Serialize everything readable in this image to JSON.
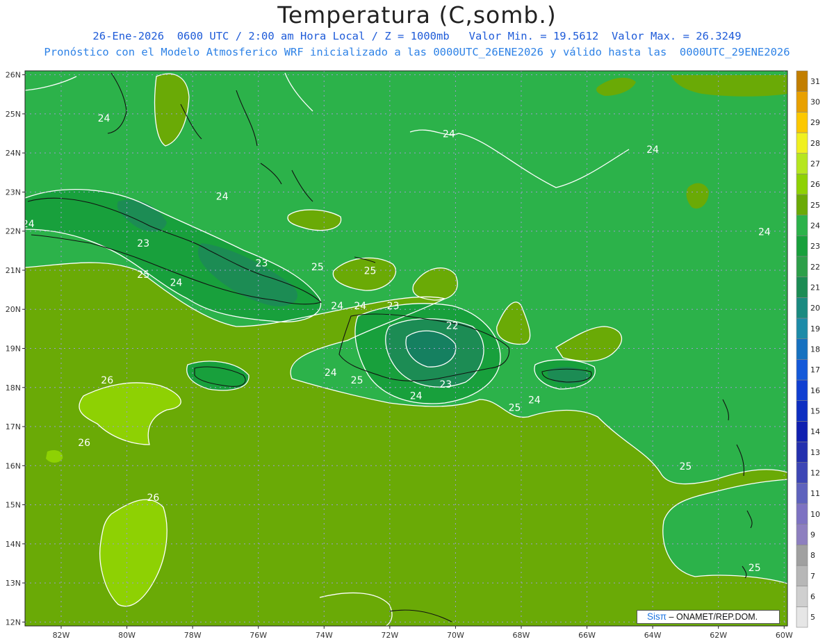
{
  "title": "Temperatura (C,somb.)",
  "subtitle_1": "26-Ene-2026  0600 UTC / 2:00 am Hora Local / Z = 1000mb   Valor Min. = 19.5612  Valor Max. = 26.3249",
  "subtitle_2": "Pronóstico con el Modelo Atmosferico WRF inicializado a las 0000UTC_26ENE2026 y válido hasta las  0000UTC_29ENE2026",
  "credit": {
    "brand": "Sisπ",
    "text": " – ONAMET/REP.DOM."
  },
  "map": {
    "lon_range": [
      -83.1,
      -59.9
    ],
    "lat_range": [
      11.9,
      26.1
    ],
    "lon_ticks": [
      "82W",
      "80W",
      "78W",
      "76W",
      "74W",
      "72W",
      "70W",
      "68W",
      "66W",
      "64W",
      "62W",
      "60W"
    ],
    "lat_ticks": [
      "12N",
      "13N",
      "14N",
      "15N",
      "16N",
      "17N",
      "18N",
      "19N",
      "20N",
      "21N",
      "22N",
      "23N",
      "24N",
      "25N",
      "26N"
    ],
    "gridlines": true,
    "fill_colors": {
      "22": "#1c8c54",
      "23": "#18a03c",
      "24": "#2cb24a",
      "25": "#6aaa06",
      "26": "#8ed103",
      "21_core": "#158060"
    },
    "contour_labels": [
      {
        "text": "24",
        "lon": -80.7,
        "lat": 24.8
      },
      {
        "text": "24",
        "lon": -70.2,
        "lat": 24.4
      },
      {
        "text": "24",
        "lon": -64.0,
        "lat": 24.0
      },
      {
        "text": "24",
        "lon": -77.1,
        "lat": 22.8
      },
      {
        "text": "24",
        "lon": -83.0,
        "lat": 22.1
      },
      {
        "text": "24",
        "lon": -60.6,
        "lat": 21.9
      },
      {
        "text": "23",
        "lon": -79.5,
        "lat": 21.6
      },
      {
        "text": "23",
        "lon": -75.9,
        "lat": 21.1
      },
      {
        "text": "25",
        "lon": -74.2,
        "lat": 21.0
      },
      {
        "text": "25",
        "lon": -72.6,
        "lat": 20.9
      },
      {
        "text": "25",
        "lon": -79.5,
        "lat": 20.8
      },
      {
        "text": "24",
        "lon": -78.5,
        "lat": 20.6
      },
      {
        "text": "24",
        "lon": -73.6,
        "lat": 20.0
      },
      {
        "text": "24",
        "lon": -72.9,
        "lat": 20.0
      },
      {
        "text": "23",
        "lon": -71.9,
        "lat": 20.0
      },
      {
        "text": "22",
        "lon": -70.1,
        "lat": 19.5
      },
      {
        "text": "24",
        "lon": -73.8,
        "lat": 18.3
      },
      {
        "text": "25",
        "lon": -73.0,
        "lat": 18.1
      },
      {
        "text": "23",
        "lon": -70.3,
        "lat": 18.0
      },
      {
        "text": "24",
        "lon": -71.2,
        "lat": 17.7
      },
      {
        "text": "24",
        "lon": -67.6,
        "lat": 17.6
      },
      {
        "text": "25",
        "lon": -68.2,
        "lat": 17.4
      },
      {
        "text": "26",
        "lon": -80.6,
        "lat": 18.1
      },
      {
        "text": "26",
        "lon": -81.3,
        "lat": 16.5
      },
      {
        "text": "26",
        "lon": -79.2,
        "lat": 15.1
      },
      {
        "text": "25",
        "lon": -63.0,
        "lat": 15.9
      },
      {
        "text": "25",
        "lon": -60.9,
        "lat": 13.3
      }
    ]
  },
  "colorbar": {
    "levels": [
      "5",
      "6",
      "7",
      "8",
      "9",
      "10",
      "11",
      "12",
      "13",
      "14",
      "15",
      "16",
      "17",
      "18",
      "19",
      "20",
      "21",
      "22",
      "23",
      "24",
      "25",
      "26",
      "27",
      "28",
      "29",
      "30",
      "31"
    ],
    "colors": [
      "#e6e6e6",
      "#cfcfcf",
      "#b7b7b7",
      "#a0a0a0",
      "#8d7fbf",
      "#7d72c2",
      "#5e62bd",
      "#3d46b5",
      "#2430ae",
      "#1020b0",
      "#0d2ec1",
      "#103fd1",
      "#1459d9",
      "#1671c0",
      "#1d8ba8",
      "#1a8a80",
      "#1c8c54",
      "#2d9f49",
      "#18a03c",
      "#2cb24a",
      "#6aaa06",
      "#8ed103",
      "#b6e61f",
      "#f0f020",
      "#fcc800",
      "#e8a000",
      "#c27e00"
    ]
  }
}
